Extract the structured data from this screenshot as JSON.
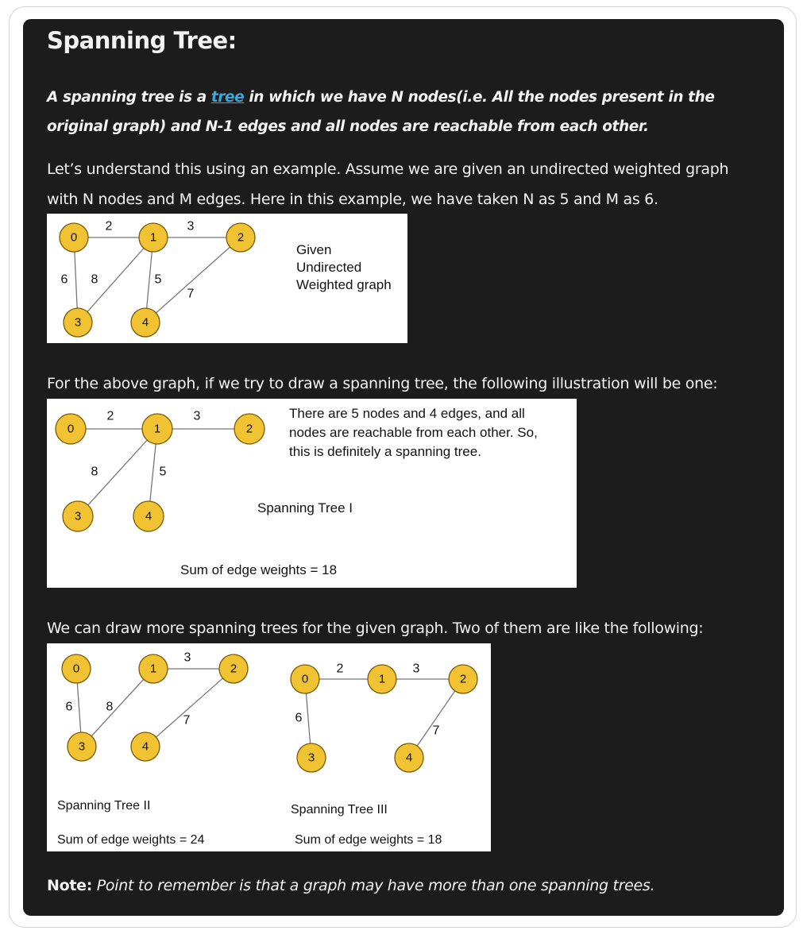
{
  "heading": "Spanning Tree:",
  "definition": {
    "before": "A spanning tree is a ",
    "link": "tree",
    "after": " in which we have N nodes(i.e. All the nodes present in the original graph) and N-1 edges and all nodes are reachable from each other."
  },
  "para1": "Let’s understand this using an example. Assume we are given an undirected weighted graph with N nodes and M edges. Here in this example, we have taken N as 5 and M as 6.",
  "para2": "For the above graph, if we try to draw a spanning tree, the following illustration will be one:",
  "para3": "We can draw more spanning trees for the given graph. Two of them are like the following:",
  "note": {
    "label": "Note:",
    "text": " Point to remember is that a graph may have more than one spanning trees."
  },
  "colors": {
    "panel": "#1c1c1c",
    "text": "#f2f2f2",
    "link": "#3aa8d8",
    "node": "#f1c232"
  },
  "figure1": {
    "nodes": [
      "0",
      "1",
      "2",
      "3",
      "4"
    ],
    "edge_labels": [
      "2",
      "3",
      "6",
      "8",
      "5",
      "7"
    ],
    "caption": [
      "Given",
      "Undirected",
      "Weighted graph"
    ]
  },
  "figure2": {
    "nodes": [
      "0",
      "1",
      "2",
      "3",
      "4"
    ],
    "edge_labels": [
      "2",
      "3",
      "8",
      "5"
    ],
    "description": [
      "There are 5 nodes and 4 edges, and all",
      "nodes are reachable from each other. So,",
      "this is definitely a spanning tree."
    ],
    "title": "Spanning Tree I",
    "sum": "Sum of edge weights = 18"
  },
  "figure3": {
    "left": {
      "nodes": [
        "0",
        "1",
        "2",
        "3",
        "4"
      ],
      "edge_labels": [
        "3",
        "6",
        "8",
        "7"
      ],
      "title": "Spanning Tree II",
      "sum": "Sum of edge weights = 24"
    },
    "right": {
      "nodes": [
        "0",
        "1",
        "2",
        "3",
        "4"
      ],
      "edge_labels": [
        "2",
        "3",
        "6",
        "7"
      ],
      "title": "Spanning Tree III",
      "sum": "Sum of edge weights = 18"
    }
  }
}
